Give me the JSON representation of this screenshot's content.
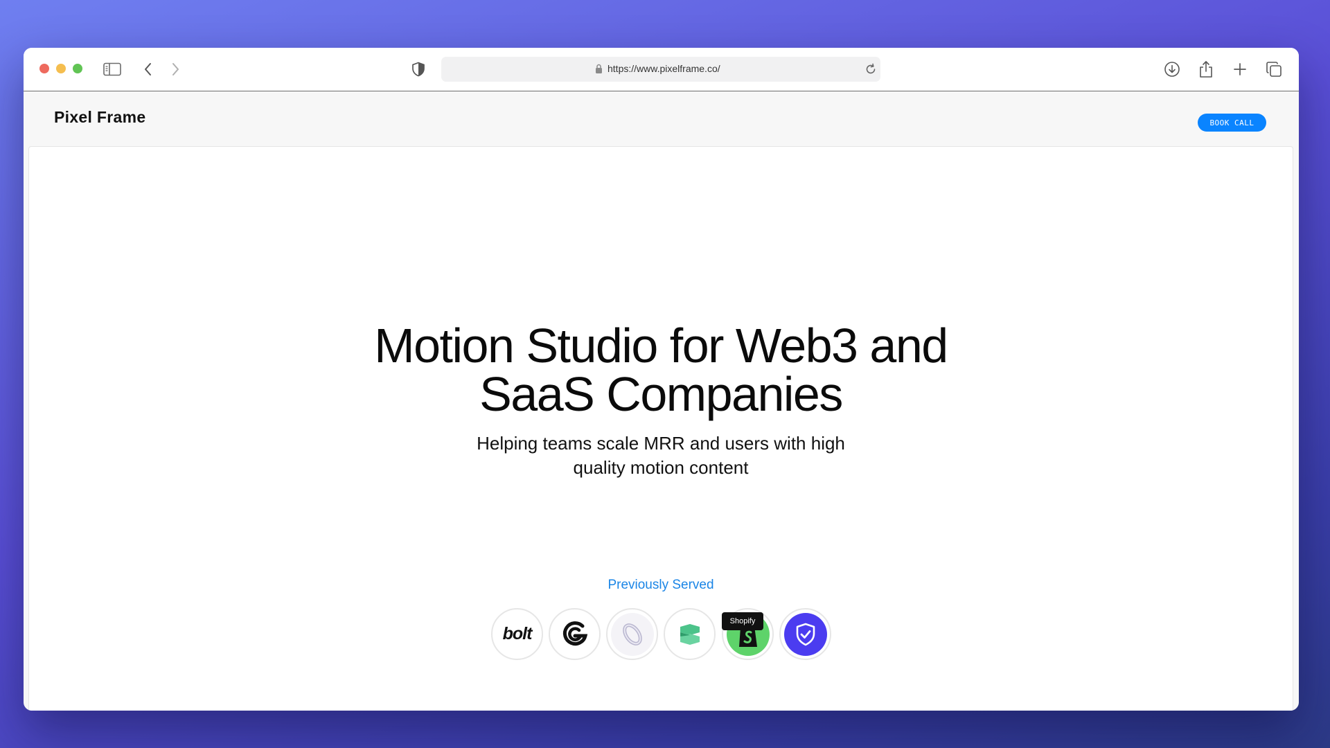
{
  "browser": {
    "url": "https://www.pixelframe.co/",
    "icons": [
      "sidebar-icon",
      "back-icon",
      "forward-icon",
      "shield-icon",
      "lock-icon",
      "reload-icon",
      "download-icon",
      "share-icon",
      "new-tab-icon",
      "tabs-overview-icon"
    ]
  },
  "header": {
    "logo": "Pixel Frame",
    "cta_label": "BOOK CALL",
    "cta_color": "#0a84ff"
  },
  "hero": {
    "title_line1": "Motion Studio for Web3 and",
    "title_line2": "SaaS Companies",
    "subtitle_line1": "Helping teams scale MRR and users with high",
    "subtitle_line2": "quality motion content"
  },
  "clients": {
    "label": "Previously Served",
    "label_color": "#1a85e6",
    "logos": [
      {
        "icon": "bolt-logo-icon",
        "text": "bolt"
      },
      {
        "icon": "g-swirl-logo-icon"
      },
      {
        "icon": "ring-logo-icon"
      },
      {
        "icon": "green-s-logo-icon"
      },
      {
        "icon": "shopify-logo-icon"
      },
      {
        "icon": "shield-check-logo-icon"
      }
    ],
    "tooltip": "Shopify"
  }
}
